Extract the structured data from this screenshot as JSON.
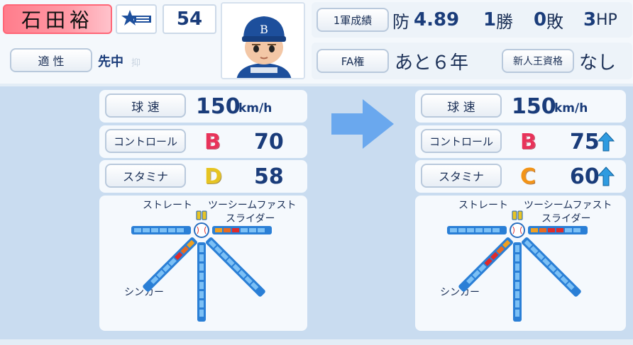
{
  "player": {
    "name": "石田裕",
    "number": "54",
    "team_logo": "baystars-star-logo"
  },
  "header": {
    "aptitude_label": "適 性",
    "aptitude_value": "先中",
    "aptitude_faded": "抑",
    "first_team_label": "1軍成績",
    "era_prefix": "防",
    "era_value": "4.89",
    "wins_value": "1",
    "wins_suffix": "勝",
    "losses_value": "0",
    "losses_suffix": "敗",
    "holds_value": "3",
    "holds_suffix": "HP",
    "fa_label": "FA権",
    "fa_value": "あと６年",
    "rookie_label": "新人王資格",
    "rookie_value": "なし"
  },
  "before": {
    "velocity_label": "球 速",
    "velocity_value": "150",
    "velocity_unit": "km/h",
    "control_label": "コントロール",
    "control_grade": "B",
    "control_value": "70",
    "stamina_label": "スタミナ",
    "stamina_grade": "D",
    "stamina_value": "58"
  },
  "after": {
    "velocity_label": "球 速",
    "velocity_value": "150",
    "velocity_unit": "km/h",
    "control_label": "コントロール",
    "control_grade": "B",
    "control_value": "75",
    "stamina_label": "スタミナ",
    "stamina_grade": "C",
    "stamina_value": "60"
  },
  "pitches": {
    "straight": "ストレート",
    "two_seam": "ツーシームファスト",
    "slider": "スライダー",
    "sinker": "シンカー"
  },
  "colors": {
    "accent_blue": "#1a3c7a",
    "grade_b": "#e8335a",
    "grade_c": "#f29418",
    "grade_d": "#e6c422",
    "arrow": "#6aa8ee",
    "up_arrow": "#2f9be0"
  },
  "icons": {
    "arrow": "right-arrow-icon",
    "up": "up-arrow-icon",
    "ball": "baseball-icon"
  }
}
